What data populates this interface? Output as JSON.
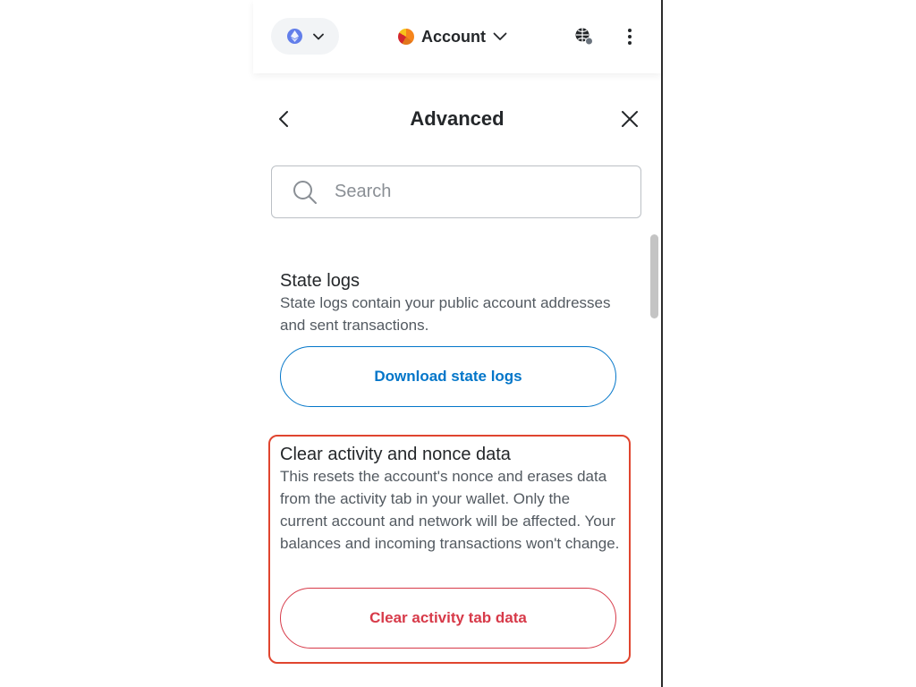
{
  "header": {
    "network_icon": "ethereum-icon",
    "account_label": "Account",
    "connect_icon": "connected-sites-icon",
    "menu_icon": "kebab-menu-icon"
  },
  "page": {
    "title": "Advanced"
  },
  "search": {
    "placeholder": "Search",
    "value": ""
  },
  "sections": {
    "state_logs": {
      "title": "State logs",
      "description": "State logs contain your public account addresses and sent transactions.",
      "button_label": "Download state logs"
    },
    "clear_activity": {
      "title": "Clear activity and nonce data",
      "description": "This resets the account's nonce and erases data from the activity tab in your wallet. Only the current account and network will be affected. Your balances and incoming transactions won't change.",
      "button_label": "Clear activity tab data"
    }
  },
  "colors": {
    "accent_blue": "#0376c9",
    "danger_red": "#d73a49",
    "highlight_border": "#e0452f",
    "ethereum": "#627eea"
  }
}
